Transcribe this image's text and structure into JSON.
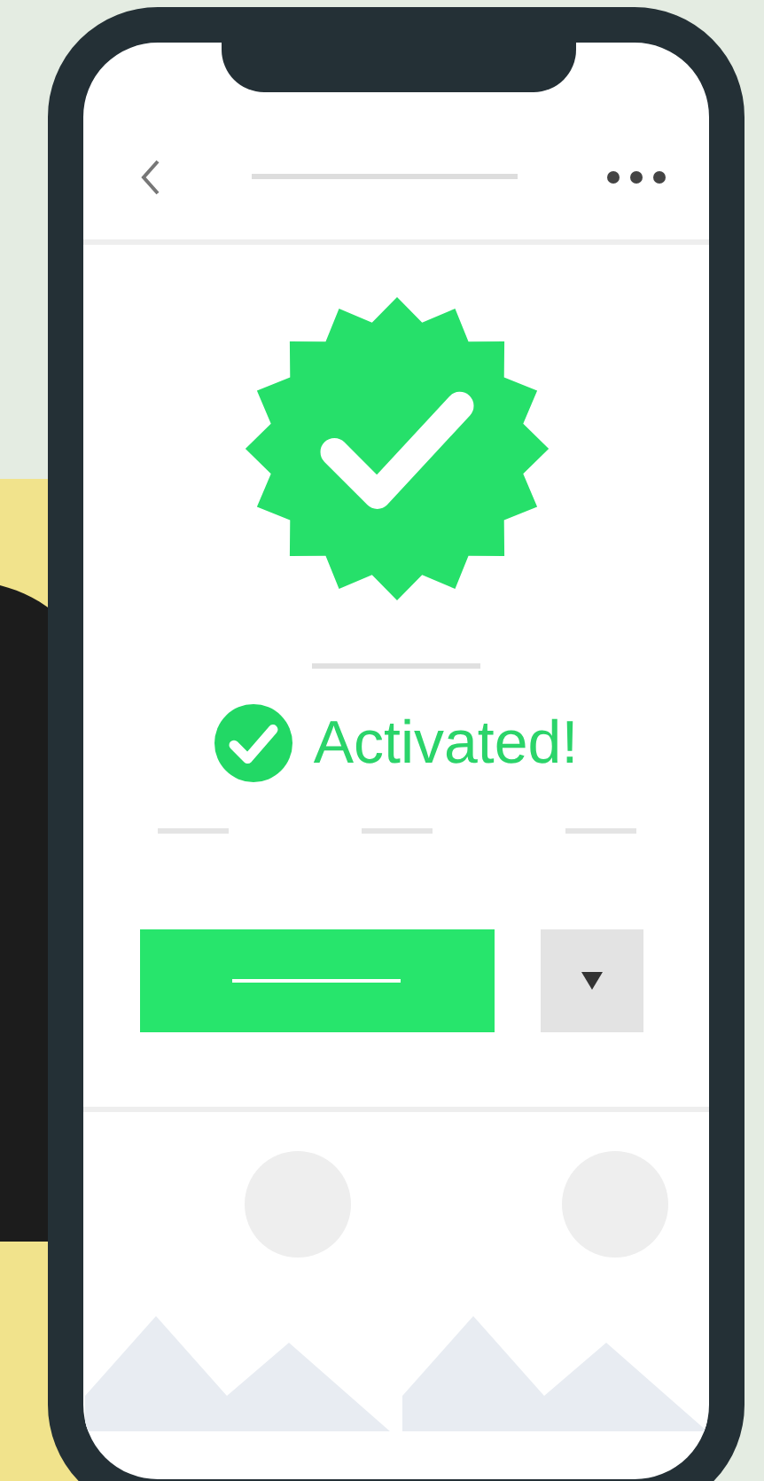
{
  "status": {
    "text": "Activated!"
  }
}
